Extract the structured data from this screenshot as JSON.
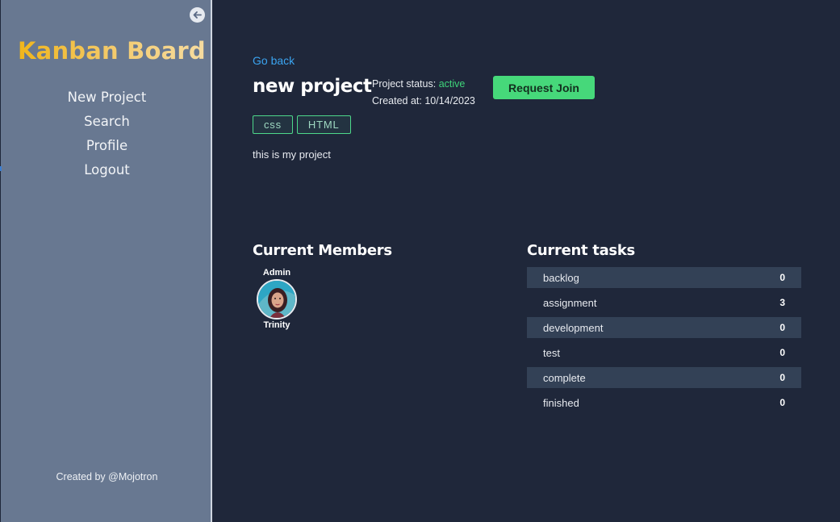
{
  "sidebar": {
    "brand": "Kanban Board",
    "collapse_icon": "arrow-left-circle-icon",
    "nav": [
      "New Project",
      "Search",
      "Profile",
      "Logout"
    ],
    "footer": "Created by @Mojotron"
  },
  "project": {
    "go_back": "Go back",
    "title": "new project",
    "status_label": "Project status:",
    "status_value": "active",
    "created_label": "Created at:",
    "created_value": "10/14/2023",
    "join_button": "Request Join",
    "tags": [
      "css",
      "HTML"
    ],
    "description": "this is my project"
  },
  "members": {
    "title": "Current Members",
    "list": [
      {
        "role": "Admin",
        "name": "Trinity"
      }
    ]
  },
  "tasks": {
    "title": "Current tasks",
    "rows": [
      {
        "name": "backlog",
        "count": "0"
      },
      {
        "name": "assignment",
        "count": "3"
      },
      {
        "name": "development",
        "count": "0"
      },
      {
        "name": "test",
        "count": "0"
      },
      {
        "name": "complete",
        "count": "0"
      },
      {
        "name": "finished",
        "count": "0"
      }
    ]
  },
  "colors": {
    "sidebar_bg": "#687891",
    "main_bg": "#1f273a",
    "accent_link": "#3ba4f0",
    "status_active": "#3fd57a",
    "button_green": "#46d87a"
  }
}
